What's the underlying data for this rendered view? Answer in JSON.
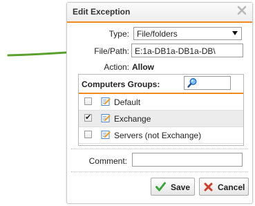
{
  "dialog": {
    "title": "Edit Exception",
    "type_label": "Type:",
    "type_value": "File/folders",
    "filepath_label": "File/Path:",
    "filepath_value": "E:1a-DB1a-DB1a-DB\\",
    "action_label": "Action:",
    "action_value": "Allow",
    "groups_title": "Computers Groups:",
    "search_value": "",
    "groups": [
      {
        "label": "Default",
        "checked": false
      },
      {
        "label": "Exchange",
        "checked": true
      },
      {
        "label": "Servers (not Exchange)",
        "checked": false
      }
    ],
    "comment_label": "Comment:",
    "comment_value": "",
    "save_label": "Save",
    "cancel_label": "Cancel"
  },
  "colors": {
    "accent": "#f08a1c",
    "arrow": "#5aa02c",
    "save_icon": "#3aa53a",
    "cancel_icon": "#d43a2a"
  }
}
